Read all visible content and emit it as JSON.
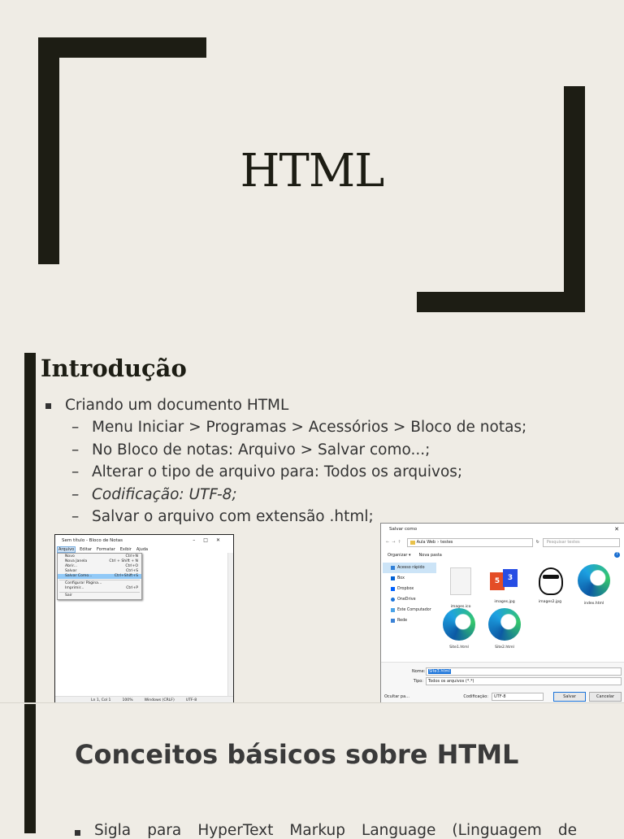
{
  "slide1": {
    "title": "HTML"
  },
  "slide2": {
    "heading": "Introdução",
    "bullet": "Criando um documento HTML",
    "subitems": [
      "Menu Iniciar > Programas > Acessórios > Bloco de notas;",
      "No Bloco de notas: Arquivo > Salvar como...;",
      "Alterar o tipo de arquivo para: Todos os arquivos;",
      "Codificação: UTF-8;",
      "Salvar o arquivo com extensão .html;"
    ],
    "notepad": {
      "window_title": "Sem título - Bloco de Notas",
      "menu": [
        "Arquivo",
        "Editar",
        "Formatar",
        "Exibir",
        "Ajuda"
      ],
      "dropdown": [
        {
          "label": "Novo",
          "shortcut": "Ctrl+N"
        },
        {
          "label": "Nova Janela",
          "shortcut": "Ctrl + Shift + N"
        },
        {
          "label": "Abrir...",
          "shortcut": "Ctrl+O"
        },
        {
          "label": "Salvar",
          "shortcut": "Ctrl+S"
        },
        {
          "label": "Salvar Como...",
          "shortcut": "Ctrl+Shift+S"
        },
        {
          "label": "Configurar Página...",
          "shortcut": ""
        },
        {
          "label": "Imprimir...",
          "shortcut": "Ctrl+P"
        },
        {
          "label": "Sair",
          "shortcut": ""
        }
      ],
      "status": [
        "Ln 1, Col 1",
        "100%",
        "Windows (CRLF)",
        "UTF-8"
      ]
    },
    "dialog": {
      "title": "Salvar como",
      "path": [
        "Aula Web",
        "testes"
      ],
      "search_placeholder": "Pesquisar testes",
      "toolbar": [
        "Organizar ▾",
        "Nova pasta"
      ],
      "nav": [
        "Acesso rápido",
        "Box",
        "Dropbox",
        "OneDrive",
        "Este Computador",
        "Rede"
      ],
      "files": [
        "images.ico",
        "images.jpg",
        "images2.jpg",
        "index.html",
        "Site1.html",
        "Site2.html"
      ],
      "name_label": "Nome:",
      "name_value": "Site3.html",
      "type_label": "Tipo:",
      "type_value": "Todos os arquivos (*.*)",
      "hide_folders": "Ocultar pa...",
      "encoding_label": "Codificação:",
      "encoding_value": "UTF-8",
      "save_button": "Salvar",
      "cancel_button": "Cancelar"
    }
  },
  "slide3": {
    "heading": "Conceitos básicos sobre HTML",
    "bullet": "Sigla para HyperText Markup Language (Linguagem de"
  },
  "colors": {
    "background": "#efece5",
    "accent": "#1d1d14"
  }
}
